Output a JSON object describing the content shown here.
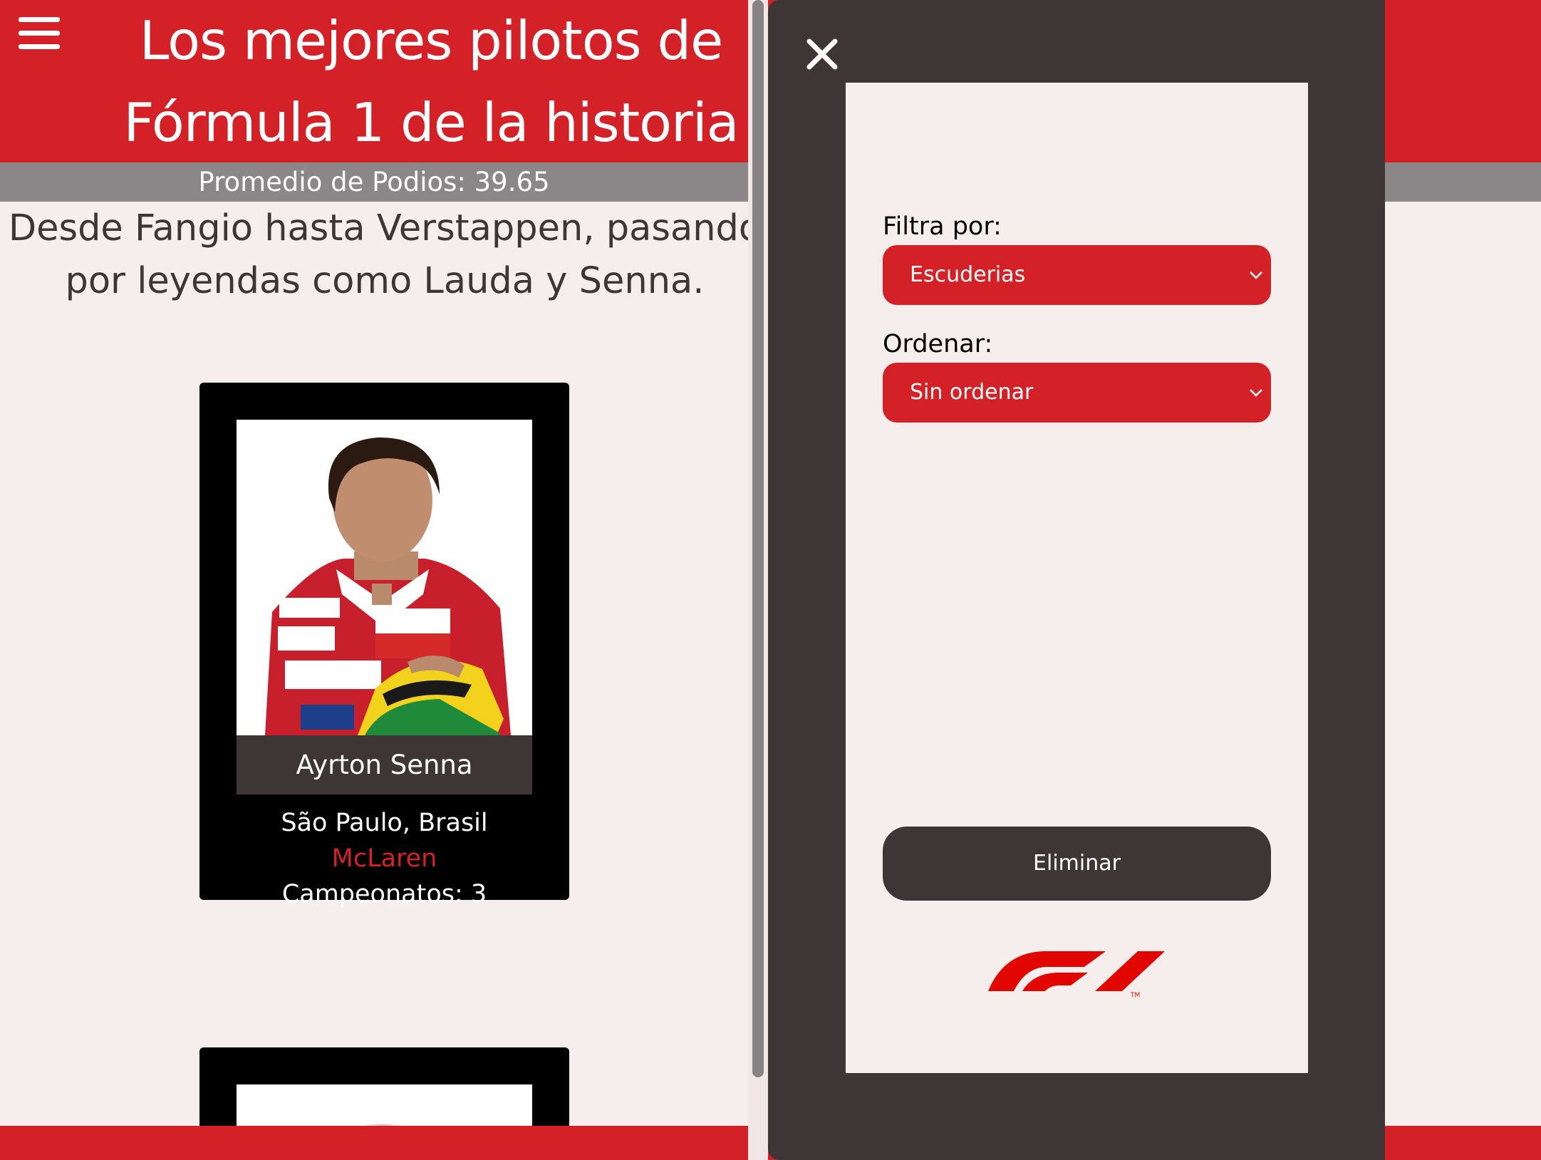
{
  "page": {
    "title_line1": "Los mejores pilotos de",
    "title_line2": "Fórmula 1 de la historia",
    "stats": "Promedio de Podios: 39.65",
    "subtitle_line1": "Desde Fangio hasta Verstappen, pasando",
    "subtitle_line2": "por leyendas como Lauda y Senna."
  },
  "cards": [
    {
      "name": "Ayrton Senna",
      "place": "São Paulo, Brasil",
      "team": "McLaren",
      "championships": "Campeonatos: 3"
    }
  ],
  "drawer": {
    "filter_label": "Filtra por:",
    "filter_value": "Escuderias",
    "order_label": "Ordenar:",
    "order_value": "Sin ordenar",
    "delete_label": "Eliminar"
  },
  "colors": {
    "brand_red": "#d42127",
    "dark": "#3d3536",
    "background": "#f6eded",
    "stats_bar": "#8b8788"
  },
  "icons": {
    "menu": "hamburger-icon",
    "close": "close-icon",
    "select_arrow": "chevron-down-icon",
    "logo": "f1-logo"
  }
}
